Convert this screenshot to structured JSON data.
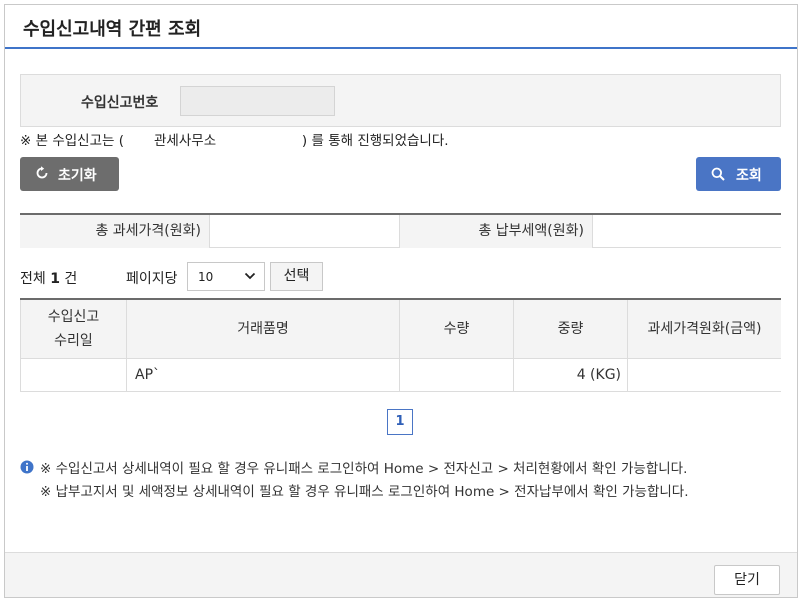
{
  "dialog": {
    "title": "수입신고내역 간편 조회"
  },
  "search": {
    "label": "수입신고번호",
    "value": ""
  },
  "notice": "※ 본 수입신고는 (       관세사무소                    ) 를 통해 진행되었습니다.",
  "buttons": {
    "reset": "초기화",
    "search": "조회",
    "select": "선택",
    "close": "닫기"
  },
  "summary": {
    "taxable_label": "총 과세가격(원화)",
    "taxable_value": "",
    "payment_label": "총 납부세액(원화)",
    "payment_value": ""
  },
  "listinfo": {
    "total_prefix": "전체 ",
    "total_count": "1",
    "total_suffix": " 건",
    "per_page_label": "페이지당",
    "per_page_value": "10"
  },
  "table": {
    "headers": [
      "수입신고\n수리일",
      "거래품명",
      "수량",
      "중량",
      "과세가격원화(금액)"
    ],
    "rows": [
      {
        "date": "",
        "item": "AP`",
        "qty": "",
        "weight": "4 (KG)",
        "price": ""
      }
    ]
  },
  "pagination": {
    "current": "1"
  },
  "info_lines": [
    "※ 수입신고서 상세내역이 필요 할 경우 유니패스 로그인하여 Home > 전자신고 > 처리현황에서 확인 가능합니다.",
    "※ 납부고지서 및 세액정보 상세내역이 필요 할 경우 유니패스 로그인하여 Home > 전자납부에서 확인 가능합니다."
  ],
  "icons": {
    "reset": "refresh-icon",
    "search": "search-icon",
    "info": "info-icon",
    "dropdown": "chevron-down-icon"
  },
  "colors": {
    "accent": "#3f74c9",
    "search_button": "#4a75c5",
    "reset_button": "#6d6d6d"
  }
}
